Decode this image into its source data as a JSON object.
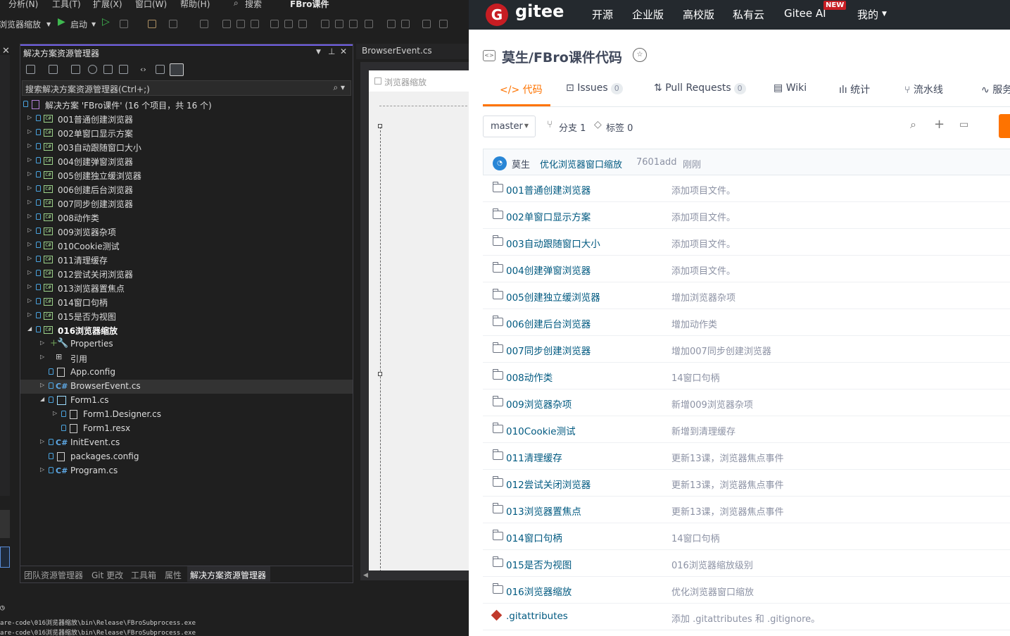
{
  "vs": {
    "menu": [
      "分析(N)",
      "工具(T)",
      "扩展(X)",
      "窗口(W)",
      "帮助(H)",
      "搜索",
      "FBro课件"
    ],
    "toolbar": {
      "project": "浏览器缩放",
      "start": "启动"
    },
    "solution_explorer": {
      "title": "解决方案资源管理器",
      "search_placeholder": "搜索解决方案资源管理器(Ctrl+;)",
      "solution": "解决方案 'FBro课件' (16 个项目，共 16 个)",
      "projects": [
        "001普通创建浏览器",
        "002单窗口显示方案",
        "003自动跟随窗口大小",
        "004创建弹窗浏览器",
        "005创建独立缓浏览器",
        "006创建后台浏览器",
        "007同步创建浏览器",
        "008动作类",
        "009浏览器杂项",
        "010Cookie测试",
        "011清理缓存",
        "012尝试关闭浏览器",
        "013浏览器置焦点",
        "014窗口句柄",
        "015是否为视图",
        "016浏览器缩放"
      ],
      "children": {
        "properties": "Properties",
        "references": "引用",
        "app_config": "App.config",
        "browser_event": "BrowserEvent.cs",
        "form1": "Form1.cs",
        "form1_designer": "Form1.Designer.cs",
        "form1_resx": "Form1.resx",
        "init_event": "InitEvent.cs",
        "packages": "packages.config",
        "program": "Program.cs"
      },
      "bottom_tabs": [
        "团队资源管理器",
        "Git 更改",
        "工具箱",
        "属性",
        "解决方案资源管理器"
      ]
    },
    "doc_tab": "BrowserEvent.cs",
    "designer_caption": "浏览器缩放",
    "output_lines": [
      "are-code\\016浏览器缩放\\bin\\Release\\FBroSubprocess.exe",
      "are-code\\016浏览器缩放\\bin\\Release\\FBroSubprocess.exe"
    ]
  },
  "gitee": {
    "brand": "gitee",
    "logo_letter": "G",
    "nav": [
      "开源",
      "企业版",
      "高校版",
      "私有云",
      "Gitee AI",
      "我的"
    ],
    "new_badge": "NEW",
    "repo_title": "莫生/FBro课件代码",
    "tabs": [
      {
        "label": "代码",
        "count": null
      },
      {
        "label": "Issues",
        "count": "0"
      },
      {
        "label": "Pull Requests",
        "count": "0"
      },
      {
        "label": "Wiki",
        "count": null
      },
      {
        "label": "统计",
        "count": null
      },
      {
        "label": "流水线",
        "count": null
      },
      {
        "label": "服务",
        "count": null
      }
    ],
    "branch": "master",
    "branch_count": "分支 1",
    "tag_count": "标签 0",
    "commit": {
      "author": "莫生",
      "message": "优化浏览器窗口缩放",
      "hash": "7601add",
      "time": "刚刚"
    },
    "files": [
      {
        "name": "001普通创建浏览器",
        "msg": "添加项目文件。"
      },
      {
        "name": "002单窗口显示方案",
        "msg": "添加项目文件。"
      },
      {
        "name": "003自动跟随窗口大小",
        "msg": "添加项目文件。"
      },
      {
        "name": "004创建弹窗浏览器",
        "msg": "添加项目文件。"
      },
      {
        "name": "005创建独立缓浏览器",
        "msg": "增加浏览器杂项"
      },
      {
        "name": "006创建后台浏览器",
        "msg": "增加动作类"
      },
      {
        "name": "007同步创建浏览器",
        "msg": "增加007同步创建浏览器"
      },
      {
        "name": "008动作类",
        "msg": "14窗口句柄"
      },
      {
        "name": "009浏览器杂项",
        "msg": "新增009浏览器杂项"
      },
      {
        "name": "010Cookie测试",
        "msg": "新增到清理缓存"
      },
      {
        "name": "011清理缓存",
        "msg": "更新13课，浏览器焦点事件"
      },
      {
        "name": "012尝试关闭浏览器",
        "msg": "更新13课，浏览器焦点事件"
      },
      {
        "name": "013浏览器置焦点",
        "msg": "更新13课，浏览器焦点事件"
      },
      {
        "name": "014窗口句柄",
        "msg": "14窗口句柄"
      },
      {
        "name": "015是否为视图",
        "msg": "016浏览器缩放级别"
      },
      {
        "name": "016浏览器缩放",
        "msg": "优化浏览器窗口缩放"
      },
      {
        "name": ".gitattributes",
        "msg": "添加 .gitattributes 和 .gitignore。"
      }
    ]
  }
}
